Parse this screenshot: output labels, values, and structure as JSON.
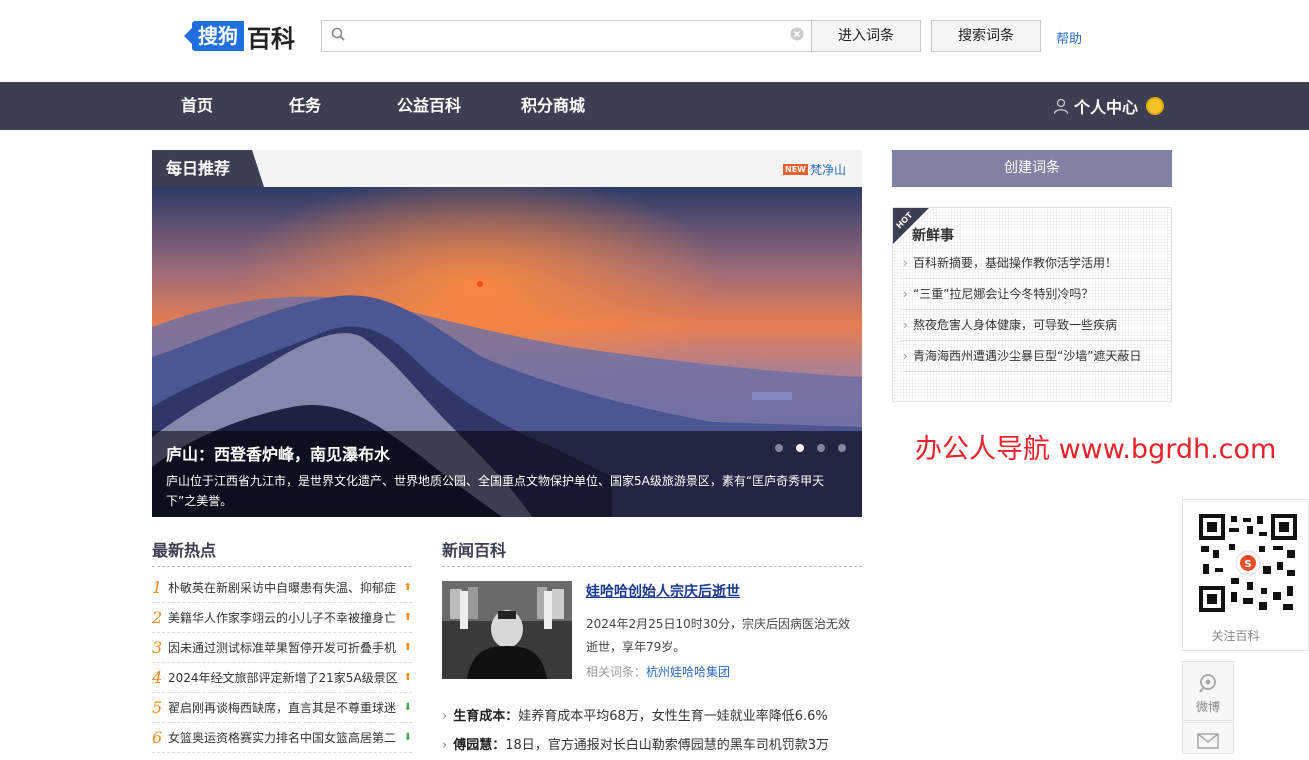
{
  "header": {
    "logo_badge": "搜狗",
    "logo_text": "百科",
    "search_placeholder": "",
    "enter_label": "进入词条",
    "search_label": "搜索词条",
    "help_label": "帮助"
  },
  "nav": {
    "items": [
      "首页",
      "任务",
      "公益百科",
      "积分商城"
    ],
    "user_center": "个人中心"
  },
  "featured": {
    "tag": "每日推荐",
    "new_badge": "NEW",
    "new_link": "梵净山",
    "title": "庐山：西登香炉峰，南见瀑布水",
    "desc": "庐山位于江西省九江市，是世界文化遗产、世界地质公园、全国重点文物保护单位、国家5A级旅游景区，素有“匡庐奇秀甲天下”之美誉。",
    "dots": 4,
    "active_dot": 1
  },
  "hot": {
    "title": "最新热点",
    "items": [
      {
        "num": "1",
        "text": "朴敏英在新剧采访中自曝患有失温、抑郁症",
        "trend": "up"
      },
      {
        "num": "2",
        "text": "美籍华人作家李翊云的小儿子不幸被撞身亡",
        "trend": "up"
      },
      {
        "num": "3",
        "text": "因未通过测试标准苹果暂停开发可折叠手机",
        "trend": "up"
      },
      {
        "num": "4",
        "text": "2024年经文旅部评定新增了21家5A级景区",
        "trend": "up"
      },
      {
        "num": "5",
        "text": "翟启刚再谈梅西缺席，直言其是不尊重球迷",
        "trend": "down"
      },
      {
        "num": "6",
        "text": "女篮奥运资格赛实力排名中国女篮高居第二",
        "trend": "down"
      }
    ]
  },
  "news": {
    "title": "新闻百科",
    "headline": "娃哈哈创始人宗庆后逝世",
    "body": "2024年2月25日10时30分，宗庆后因病医治无效逝世，享年79岁。",
    "related_label": "相关词条：",
    "related_link": "杭州娃哈哈集团",
    "lines": [
      {
        "key": "生育成本：",
        "text": "娃养育成本平均68万，女性生育一娃就业率降低6.6%"
      },
      {
        "key": "傅园慧：",
        "text": "18日，官方通报对长白山勒索傅园慧的黑车司机罚款3万"
      }
    ]
  },
  "right": {
    "create_label": "创建词条",
    "hot_corner": "HOT",
    "fresh_title": "新鲜事",
    "fresh_items": [
      "百科新摘要，基础操作教你活学活用！",
      "“三重”拉尼娜会让今冬特别冷吗？",
      "熬夜危害人身体健康，可导致一些疾病",
      "青海海西州遭遇沙尘暴巨型“沙墙”遮天蔽日"
    ]
  },
  "watermark": "办公人导航 www.bgrdh.com",
  "side": {
    "qr_label": "关注百科",
    "weibo_label": "微博"
  },
  "colors": {
    "nav_bg": "#3c3e52",
    "accent_blue": "#2a6cc4",
    "create_btn": "#8182a4",
    "hot_num": "#f08c1c",
    "watermark": "#e8232b"
  }
}
